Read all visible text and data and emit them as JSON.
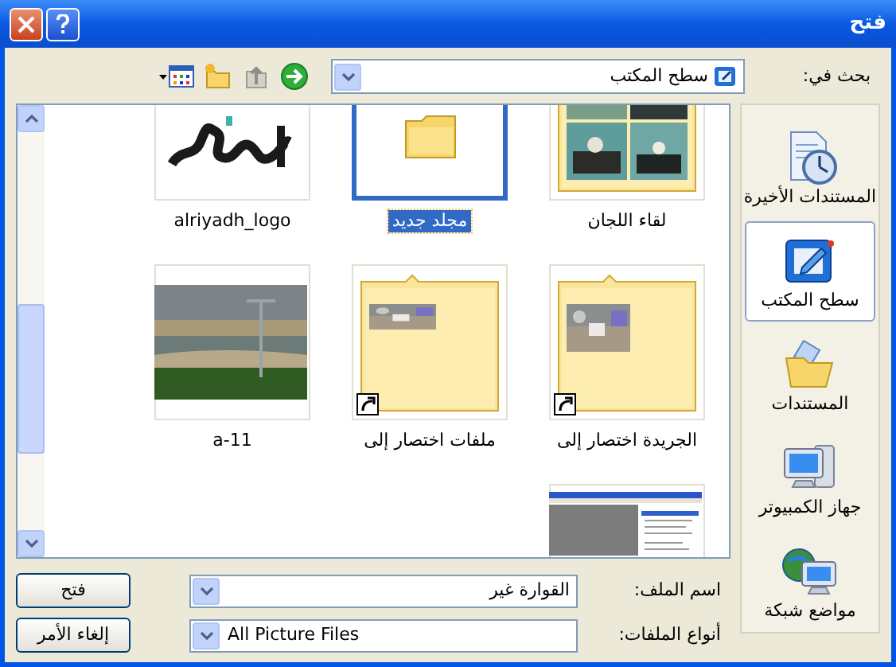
{
  "window": {
    "title": "فتح"
  },
  "look_in": {
    "label": "بحث في:",
    "value": "سطح المكتب"
  },
  "places": [
    {
      "label": "المستندات الأخيرة",
      "kind": "recent",
      "selected": false
    },
    {
      "label": "سطح المكتب",
      "kind": "desktop",
      "selected": true
    },
    {
      "label": "المستندات",
      "kind": "documents",
      "selected": false
    },
    {
      "label": "جهاز الكمبيوتر",
      "kind": "computer",
      "selected": false
    },
    {
      "label": "مواضع شبكة",
      "kind": "network",
      "selected": false
    }
  ],
  "files": [
    {
      "name": "لقاء اللجان",
      "kind": "folder-photos",
      "selected": false
    },
    {
      "name": "مجلد جديد",
      "kind": "folder",
      "selected": true
    },
    {
      "name": "alriyadh_logo",
      "selected": false
    },
    {
      "name": "الجريدة اختصار إلى",
      "kind": "shortcut",
      "selected": false
    },
    {
      "name": "ملفات اختصار إلى",
      "kind": "shortcut",
      "selected": false
    },
    {
      "name": "a-11",
      "selected": false
    },
    {
      "kind": "screenshot",
      "selected": false
    }
  ],
  "file_name": {
    "label": "اسم الملف:",
    "value": "القوارة غير"
  },
  "file_type": {
    "label": "أنواع الملفات:",
    "value": "All Picture Files"
  },
  "buttons": [
    "فتح",
    "إلغاء الأمر"
  ]
}
